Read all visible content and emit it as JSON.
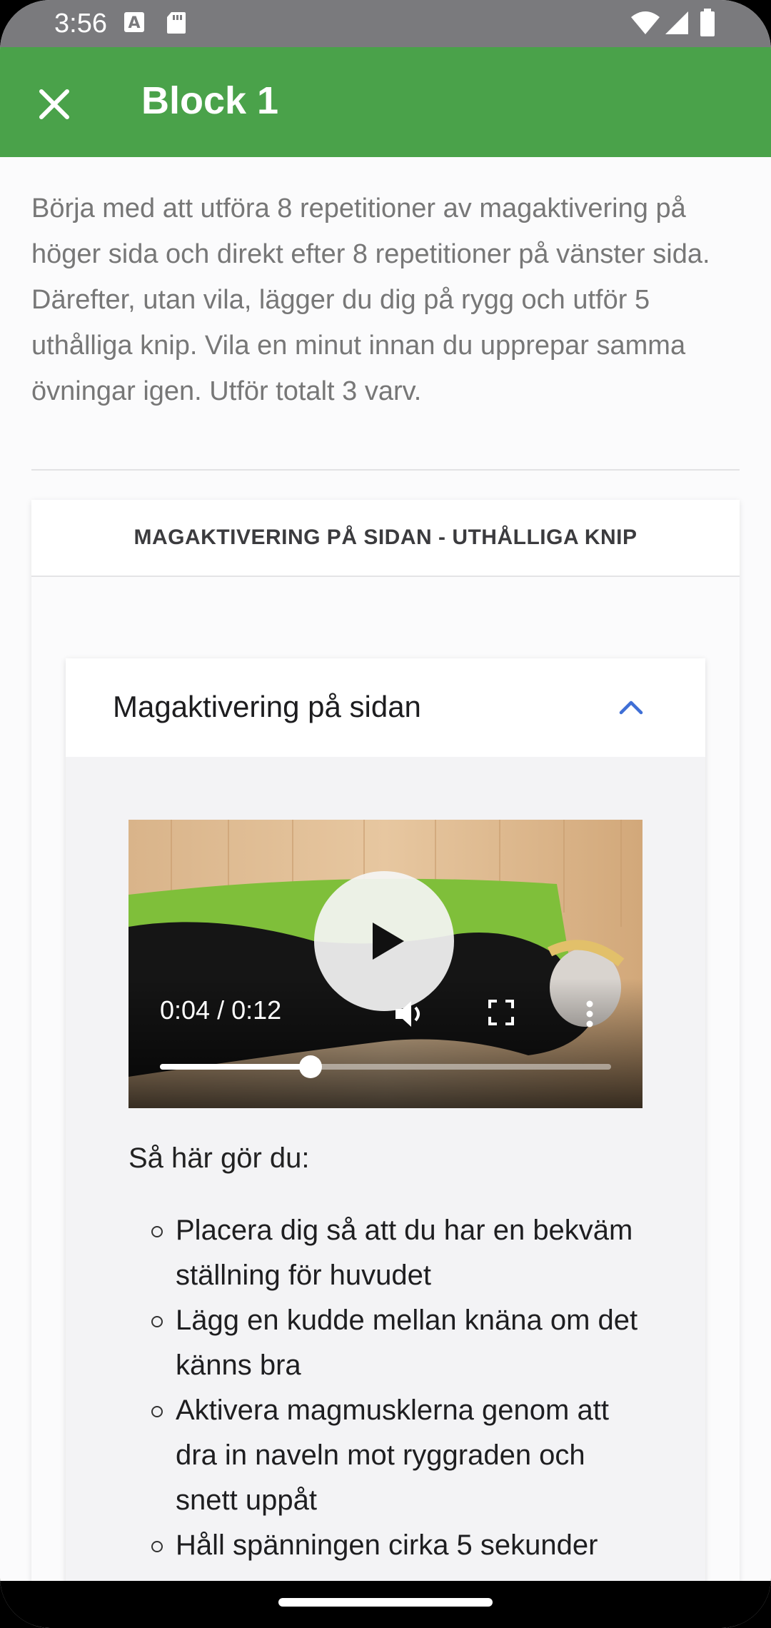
{
  "status_bar": {
    "time": "3:56"
  },
  "app_bar": {
    "title": "Block 1"
  },
  "intro_text": "Börja med att utföra 8 repetitioner av magaktivering på höger sida och direkt efter 8 repetitioner på vänster sida. Därefter, utan vila, lägger du dig på rygg och utför 5 uthålliga knip. Vila en minut innan du upprepar samma övningar igen. Utför totalt 3 varv.",
  "section": {
    "title": "MAGAKTIVERING PÅ SIDAN - UTHÅLLIGA KNIP",
    "exercise": {
      "title": "Magaktivering på sidan",
      "video": {
        "time_display": "0:04 / 0:12",
        "progress_fraction": 0.3333
      },
      "how_to_label": "Så här gör du:",
      "steps": [
        "Placera dig så att du har en bekväm ställning för huvudet",
        "Lägg en kudde mellan knäna om det känns bra",
        "Aktivera magmusklerna genom att dra in naveln mot ryggraden och snett uppåt",
        "Håll spänningen cirka 5 sekunder"
      ]
    }
  },
  "colors": {
    "app_bar": "#4aa24a",
    "accent": "#3f6fd6"
  }
}
